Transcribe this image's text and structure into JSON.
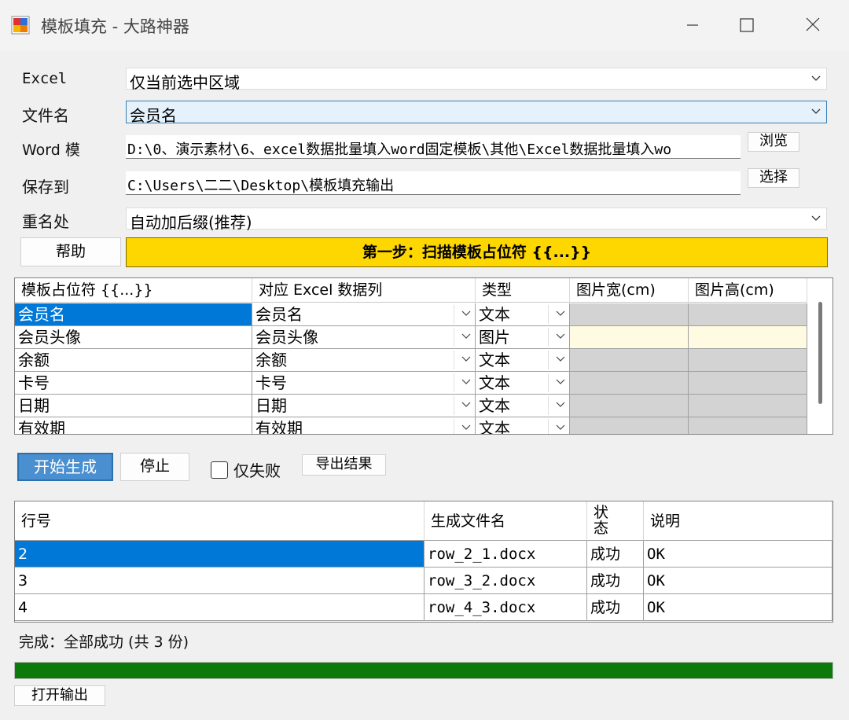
{
  "window": {
    "title": "模板填充 - 大路神器",
    "icon": "app-logo-icon",
    "controls": [
      "minimize-icon",
      "maximize-icon",
      "close-icon"
    ]
  },
  "form": {
    "excel_label": "Excel",
    "excel_value": "仅当前选中区域",
    "filename_label": "文件名",
    "filename_value": "会员名",
    "word_label": "Word 模",
    "word_value": "D:\\0、演示素材\\6、excel数据批量填入word固定模板\\其他\\Excel数据批量填入wo",
    "browse_label": "浏览",
    "save_label": "保存到",
    "save_value": "C:\\Users\\二二\\Desktop\\模板填充输出",
    "choose_label": "选择",
    "rename_label": "重名处",
    "rename_value": "自动加后缀(推荐)",
    "help_label": "帮助",
    "step_label": "第一步：扫描模板占位符 {{...}}"
  },
  "mapping": {
    "headers": [
      "模板占位符 {{...}}",
      "对应 Excel 数据列",
      "类型",
      "图片宽(cm)",
      "图片高(cm)"
    ],
    "rows": [
      {
        "placeholder": "会员名",
        "column": "会员名",
        "type": "文本",
        "w": "",
        "h": ""
      },
      {
        "placeholder": "会员头像",
        "column": "会员头像",
        "type": "图片",
        "w": "",
        "h": ""
      },
      {
        "placeholder": "余额",
        "column": "余额",
        "type": "文本",
        "w": "",
        "h": ""
      },
      {
        "placeholder": "卡号",
        "column": "卡号",
        "type": "文本",
        "w": "",
        "h": ""
      },
      {
        "placeholder": "日期",
        "column": "日期",
        "type": "文本",
        "w": "",
        "h": ""
      },
      {
        "placeholder": "有效期",
        "column": "有效期",
        "type": "文本",
        "w": "",
        "h": ""
      }
    ]
  },
  "actions": {
    "start_label": "开始生成",
    "stop_label": "停止",
    "only_failed_label": "仅失败",
    "export_label": "导出结果"
  },
  "results": {
    "headers": [
      "行号",
      "生成文件名",
      "状态",
      "说明"
    ],
    "rows": [
      {
        "row": "2",
        "file": "row_2_1.docx",
        "status": "成功",
        "note": "OK"
      },
      {
        "row": "3",
        "file": "row_3_2.docx",
        "status": "成功",
        "note": "OK"
      },
      {
        "row": "4",
        "file": "row_4_3.docx",
        "status": "成功",
        "note": "OK"
      }
    ]
  },
  "status": {
    "text": "完成：全部成功 (共 3 份)",
    "progress": 1.0,
    "progress_color": "#0b7a0b",
    "open_output_label": "打开输出"
  },
  "colors": {
    "selection": "#0078d7",
    "step_button": "#ffd700",
    "start_button": "#4a8fcf"
  }
}
